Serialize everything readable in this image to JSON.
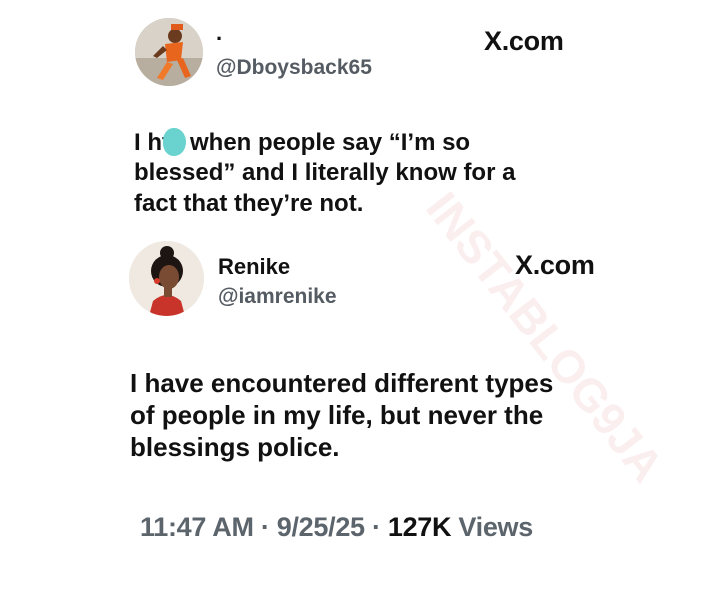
{
  "quoted_tweet": {
    "display_name": ".",
    "handle": "@Dboysback65",
    "brand": "X.com",
    "text_line1_a": "I h",
    "text_line1_b": "te when people say “I’m so",
    "text_line2": "blessed” and I literally know for a",
    "text_line3": "fact that they’re not."
  },
  "reply_tweet": {
    "display_name": "Renike",
    "handle": "@iamrenike",
    "brand": "X.com",
    "text_line1": "I have encountered different types",
    "text_line2": "of people in my life, but never the",
    "text_line3": "blessings police."
  },
  "meta": {
    "time": "11:47 AM",
    "sep1": "·",
    "date": "9/25/25",
    "sep2": "·",
    "views_count": "127K",
    "views_label": "Views"
  },
  "watermark": "INSTABLOG9JA"
}
